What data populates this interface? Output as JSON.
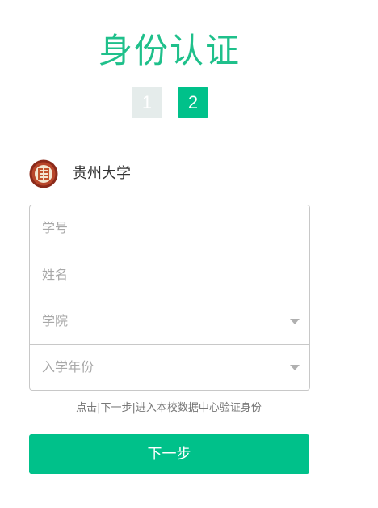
{
  "page": {
    "title": "身份认证"
  },
  "steps": [
    "1",
    "2"
  ],
  "school": {
    "logo_icon": "university-seal-icon",
    "name": "贵州大学"
  },
  "form": {
    "student_id_placeholder": "学号",
    "name_placeholder": "姓名",
    "college_placeholder": "学院",
    "enroll_year_placeholder": "入学年份"
  },
  "hint": "点击|下一步|进入本校数据中心验证身份",
  "next_button_label": "下一步",
  "colors": {
    "accent": "#00c18a",
    "title": "#1fc08b",
    "step_inactive": "#e5eceb",
    "border": "#c8c8c8"
  }
}
